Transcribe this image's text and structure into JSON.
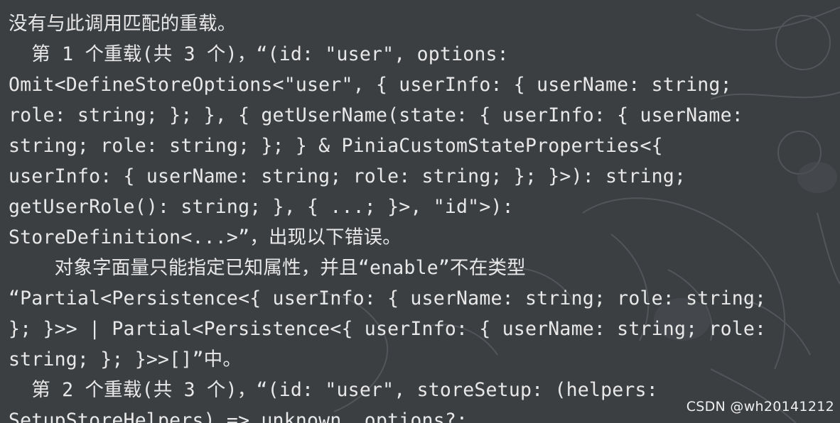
{
  "tooltip": {
    "lines": [
      "没有与此调用匹配的重载。",
      "  第 1 个重载(共 3 个)，“(id: \"user\", options:",
      "Omit<DefineStoreOptions<\"user\", { userInfo: { userName: string;",
      "role: string; }; }, { getUserName(state: { userInfo: { userName:",
      "string; role: string; }; } & PiniaCustomStateProperties<{",
      "userInfo: { userName: string; role: string; }; }>): string;",
      "getUserRole(): string; }, { ...; }>, \"id\">):",
      "StoreDefinition<...>”，出现以下错误。",
      "    对象字面量只能指定已知属性，并且“enable”不在类型",
      "“Partial<Persistence<{ userInfo: { userName: string; role: string;",
      "}; }>> | Partial<Persistence<{ userInfo: { userName: string; role:",
      "string; }; }>>[]”中。",
      "  第 2 个重载(共 3 个)，“(id: \"user\", storeSetup: (helpers:",
      "SetupStoreHelpers) => unknown, options?:"
    ]
  },
  "watermark": "CSDN @wh20141212",
  "colors": {
    "background": "#3c3f42",
    "text": "#e8e8e8"
  }
}
